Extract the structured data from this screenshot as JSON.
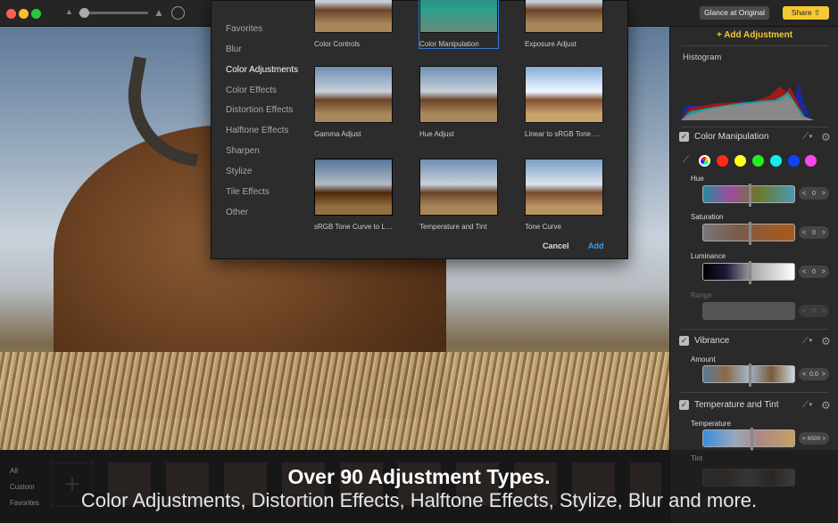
{
  "toolbar": {
    "glance_label": "Glance at Original",
    "share_label": "Share"
  },
  "dialog": {
    "categories": [
      "Favorites",
      "Blur",
      "Color Adjustments",
      "Color Effects",
      "Distortion Effects",
      "Halftone Effects",
      "Sharpen",
      "Stylize",
      "Tile Effects",
      "Other"
    ],
    "selected": "Color Adjustments",
    "tiles": [
      "Color Controls",
      "Color Manipulation",
      "Exposure Adjust",
      "Gamma Adjust",
      "Hue Adjust",
      "Linear to sRGB Tone C...",
      "sRGB Tone Curve to Li...",
      "Temperature and Tint",
      "Tone Curve"
    ],
    "cancel": "Cancel",
    "add": "Add"
  },
  "panel": {
    "add_adjustment": "+ Add Adjustment",
    "histogram": "Histogram",
    "color_manipulation": {
      "title": "Color Manipulation",
      "swatches": [
        "#ff2a1a",
        "#ffff22",
        "#22ee22",
        "#11eeee",
        "#1144ff",
        "#ff44ee"
      ],
      "hue_label": "Hue",
      "hue": "0",
      "saturation_label": "Saturation",
      "saturation": "0",
      "luminance_label": "Luminance",
      "luminance": "0",
      "range_label": "Range",
      "range": "0"
    },
    "vibrance": {
      "title": "Vibrance",
      "amount_label": "Amount",
      "amount": "0.0"
    },
    "temperature": {
      "title": "Temperature and Tint",
      "temperature_label": "Temperature",
      "temperature": "6500",
      "tint_label": "Tint"
    }
  },
  "bottom": {
    "filters": [
      "All",
      "Custom",
      "Favorites"
    ]
  },
  "promo": {
    "headline": "Over 90 Adjustment Types.",
    "subline": "Color Adjustments, Distortion Effects, Halftone Effects, Stylize, Blur and more."
  }
}
